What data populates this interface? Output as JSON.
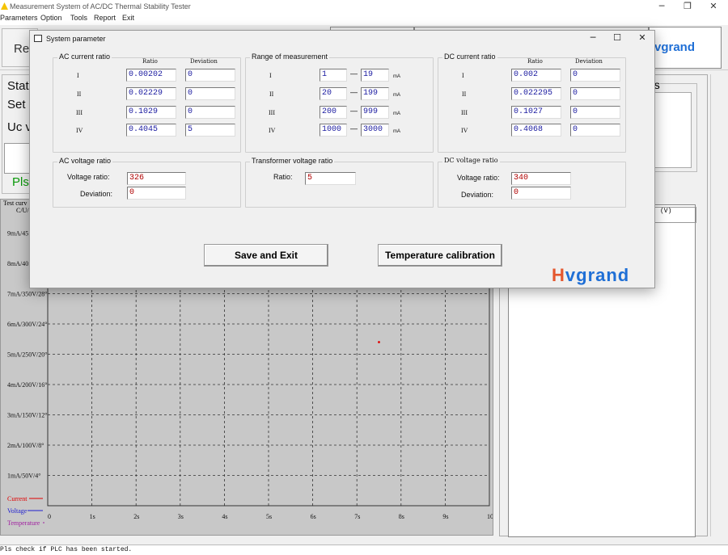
{
  "window": {
    "title": "Measurement System of AC/DC Thermal Stability Tester"
  },
  "menu": [
    "Parameters",
    "Option",
    "Tools",
    "Report",
    "Exit"
  ],
  "toolbar": {
    "left_partial": "Rea",
    "logo_partial": "vgrand"
  },
  "left_panel": {
    "status": "Statu",
    "set": "Set c",
    "uc": "Uc v",
    "pls": "Pls"
  },
  "right_panel": {
    "fragment": "ps",
    "unit": "(V)"
  },
  "chart": {
    "caption": "Test curv",
    "axis_label": "C/U/"
  },
  "chart_data": {
    "type": "line",
    "x": {
      "tick_labels": [
        "0",
        "1s",
        "2s",
        "3s",
        "4s",
        "5s",
        "6s",
        "7s",
        "8s",
        "9s",
        "10s"
      ],
      "range": [
        0,
        10
      ]
    },
    "y": {
      "tick_labels": [
        "1mA/50V/4°",
        "2mA/100V/8°",
        "3mA/150V/12°",
        "4mA/200V/16°",
        "5mA/250V/20°",
        "6mA/300V/24°",
        "7mA/350V/28°",
        "8mA/40",
        "9mA/45"
      ],
      "range": [
        0,
        10
      ]
    },
    "grid": true,
    "series": [
      {
        "name": "Current",
        "color": "#e00000",
        "points": [
          [
            7.5,
            5.4
          ]
        ]
      },
      {
        "name": "Voltage",
        "color": "#2020d0",
        "points": []
      },
      {
        "name": "Temperature",
        "color": "#a020a0",
        "points": []
      }
    ],
    "legend_position": "bottom-left"
  },
  "statusbar": {
    "text": "Pls check if PLC has been started."
  },
  "dialog": {
    "title": "System parameter",
    "ac_current_ratio": {
      "legend": "AC current ratio",
      "col_ratio": "Ratio",
      "col_deviation": "Deviation",
      "rows": [
        {
          "label": "I",
          "ratio": "0.00202",
          "deviation": "0"
        },
        {
          "label": "II",
          "ratio": "0.02229",
          "deviation": "0"
        },
        {
          "label": "III",
          "ratio": "0.1029",
          "deviation": "0"
        },
        {
          "label": "IV",
          "ratio": "0.4045",
          "deviation": "5"
        }
      ]
    },
    "range_of_measurement": {
      "legend": "Range of measurement",
      "unit": "mA",
      "rows": [
        {
          "label": "I",
          "from": "1",
          "to": "19"
        },
        {
          "label": "II",
          "from": "20",
          "to": "199"
        },
        {
          "label": "III",
          "from": "200",
          "to": "999"
        },
        {
          "label": "IV",
          "from": "1000",
          "to": "3000"
        }
      ]
    },
    "dc_current_ratio": {
      "legend": "DC current ratio",
      "col_ratio": "Ratio",
      "col_deviation": "Deviation",
      "rows": [
        {
          "label": "I",
          "ratio": "0.002",
          "deviation": "0"
        },
        {
          "label": "II",
          "ratio": "0.022295",
          "deviation": "0"
        },
        {
          "label": "III",
          "ratio": "0.1027",
          "deviation": "0"
        },
        {
          "label": "IV",
          "ratio": "0.4068",
          "deviation": "0"
        }
      ]
    },
    "ac_voltage_ratio": {
      "legend": "AC voltage ratio",
      "ratio_label": "Voltage ratio:",
      "ratio_value": "326",
      "deviation_label": "Deviation:",
      "deviation_value": "0"
    },
    "transformer_voltage_ratio": {
      "legend": "Transformer voltage ratio",
      "ratio_label": "Ratio:",
      "ratio_value": "5"
    },
    "dc_voltage_ratio": {
      "legend": "DC voltage ratio",
      "ratio_label": "Voltage ratio:",
      "ratio_value": "340",
      "deviation_label": "Deviation:",
      "deviation_value": "0"
    },
    "buttons": {
      "save": "Save and Exit",
      "temp": "Temperature calibration"
    },
    "logo": {
      "text": "Hvgrand",
      "color_main": "#1f6fd6",
      "color_accent": "#e4572e"
    }
  }
}
